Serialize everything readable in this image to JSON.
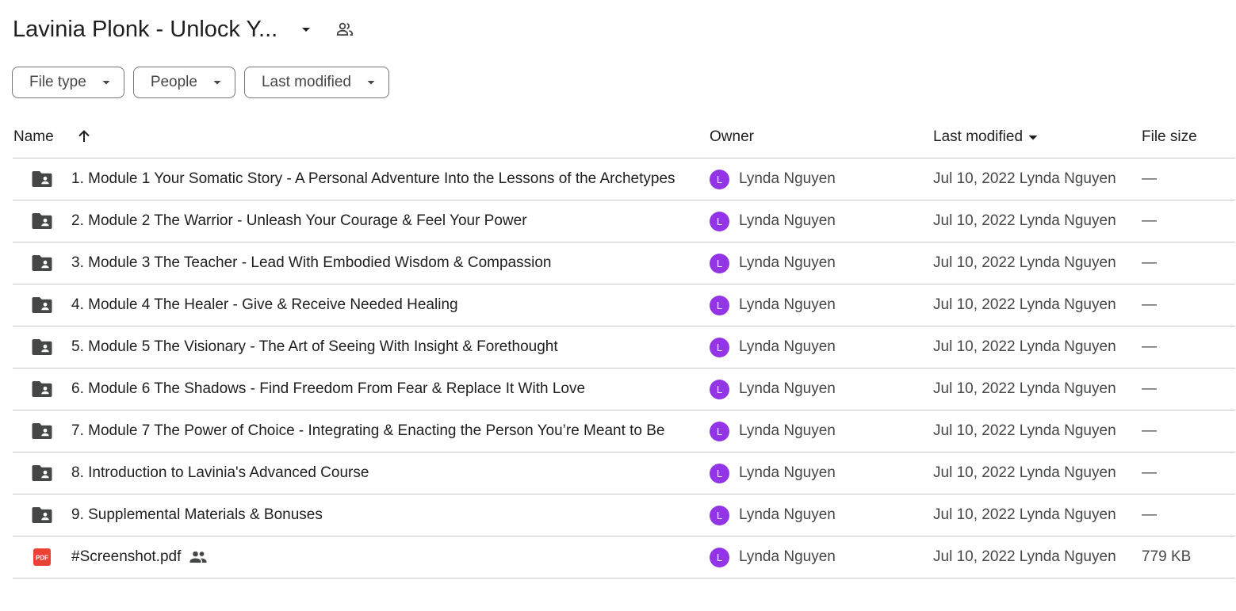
{
  "header": {
    "title": "Lavinia Plonk - Unlock Y...",
    "caret_icon": "arrow-drop-down-icon",
    "share_icon": "people-outline-icon"
  },
  "filters": [
    {
      "label": "File type"
    },
    {
      "label": "People"
    },
    {
      "label": "Last modified"
    }
  ],
  "columns": {
    "name": "Name",
    "owner": "Owner",
    "last_modified": "Last modified",
    "file_size": "File size"
  },
  "colors": {
    "avatar": "#9334e6",
    "folder": "#444746",
    "pdf": "#ea4335"
  },
  "rows": [
    {
      "type": "folder",
      "name": "1. Module 1 Your Somatic Story - A Personal Adventure Into the Lessons of the Archetypes",
      "owner_initial": "L",
      "owner": "Lynda Nguyen",
      "modified": "Jul 10, 2022 Lynda Nguyen",
      "size": "—"
    },
    {
      "type": "folder",
      "name": "2. Module 2 The Warrior - Unleash Your Courage & Feel Your Power",
      "owner_initial": "L",
      "owner": "Lynda Nguyen",
      "modified": "Jul 10, 2022 Lynda Nguyen",
      "size": "—"
    },
    {
      "type": "folder",
      "name": "3. Module 3 The Teacher - Lead With Embodied Wisdom & Compassion",
      "owner_initial": "L",
      "owner": "Lynda Nguyen",
      "modified": "Jul 10, 2022 Lynda Nguyen",
      "size": "—"
    },
    {
      "type": "folder",
      "name": "4. Module 4 The Healer - Give & Receive Needed Healing",
      "owner_initial": "L",
      "owner": "Lynda Nguyen",
      "modified": "Jul 10, 2022 Lynda Nguyen",
      "size": "—"
    },
    {
      "type": "folder",
      "name": "5. Module 5 The Visionary - The Art of Seeing With Insight & Forethought",
      "owner_initial": "L",
      "owner": "Lynda Nguyen",
      "modified": "Jul 10, 2022 Lynda Nguyen",
      "size": "—"
    },
    {
      "type": "folder",
      "name": "6. Module 6 The Shadows - Find Freedom From Fear & Replace It With Love",
      "owner_initial": "L",
      "owner": "Lynda Nguyen",
      "modified": "Jul 10, 2022 Lynda Nguyen",
      "size": "—"
    },
    {
      "type": "folder",
      "name": "7. Module 7 The Power of Choice - Integrating & Enacting the Person You’re Meant to Be",
      "owner_initial": "L",
      "owner": "Lynda Nguyen",
      "modified": "Jul 10, 2022 Lynda Nguyen",
      "size": "—"
    },
    {
      "type": "folder",
      "name": "8. Introduction to Lavinia's Advanced Course",
      "owner_initial": "L",
      "owner": "Lynda Nguyen",
      "modified": "Jul 10, 2022 Lynda Nguyen",
      "size": "—"
    },
    {
      "type": "folder",
      "name": "9. Supplemental Materials & Bonuses",
      "owner_initial": "L",
      "owner": "Lynda Nguyen",
      "modified": "Jul 10, 2022 Lynda Nguyen",
      "size": "—"
    },
    {
      "type": "pdf",
      "name": "#Screenshot.pdf",
      "shared": true,
      "owner_initial": "L",
      "owner": "Lynda Nguyen",
      "modified": "Jul 10, 2022 Lynda Nguyen",
      "size": "779 KB"
    }
  ]
}
